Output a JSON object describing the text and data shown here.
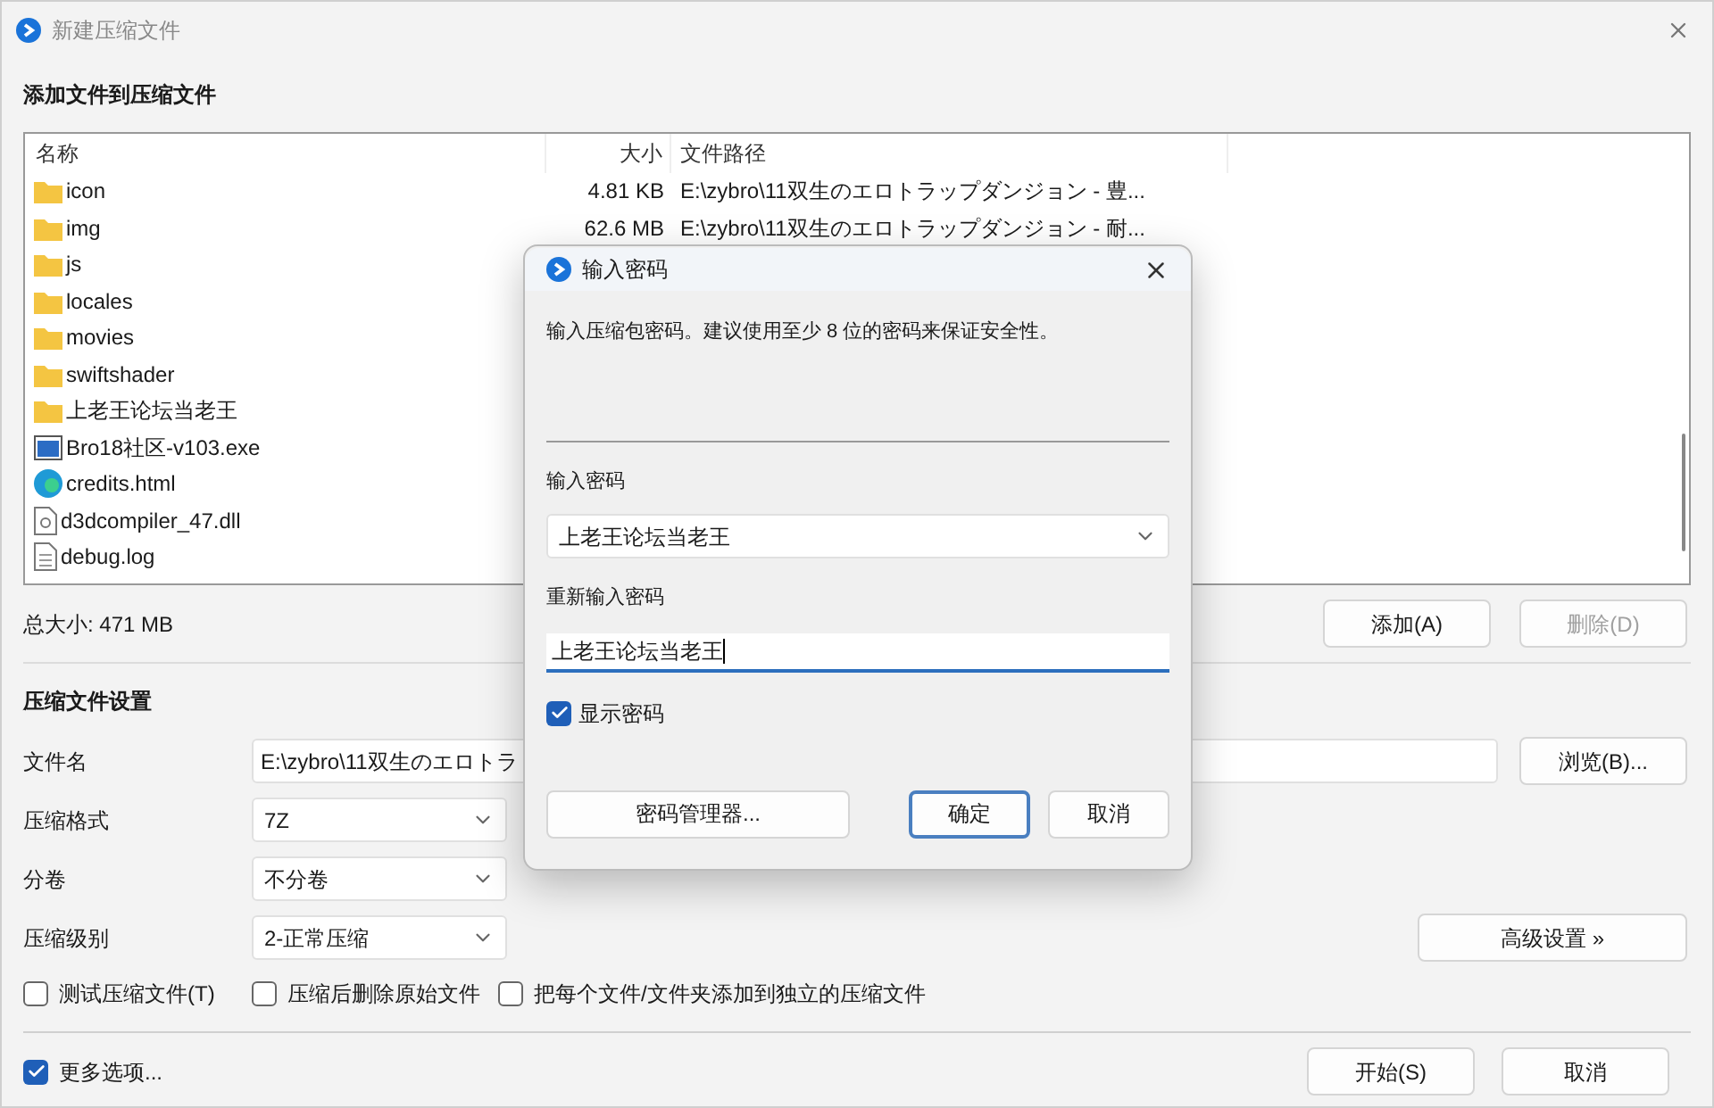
{
  "window": {
    "title": "新建压缩文件"
  },
  "files_section": {
    "heading": "添加文件到压缩文件",
    "columns": [
      "名称",
      "大小",
      "文件路径"
    ],
    "rows": [
      {
        "kind": "folder",
        "name": "icon",
        "size": "4.81 KB",
        "path": "E:\\zybro\\11双生のエロトラップダンジョン - 豊..."
      },
      {
        "kind": "folder",
        "name": "img",
        "size": "62.6 MB",
        "path": "E:\\zybro\\11双生のエロトラップダンジョン - 耐..."
      },
      {
        "kind": "folder",
        "name": "js"
      },
      {
        "kind": "folder",
        "name": "locales"
      },
      {
        "kind": "folder",
        "name": "movies"
      },
      {
        "kind": "folder",
        "name": "swiftshader"
      },
      {
        "kind": "folder",
        "name": "上老王论坛当老王"
      },
      {
        "kind": "exe",
        "name": "Bro18社区-v103.exe"
      },
      {
        "kind": "html",
        "name": "credits.html"
      },
      {
        "kind": "dll",
        "name": "d3dcompiler_47.dll"
      },
      {
        "kind": "log",
        "name": "debug.log"
      }
    ],
    "total": "总大小: 471 MB",
    "buttons": [
      {
        "label": "添加(A)",
        "disabled": false
      },
      {
        "label": "删除(D)",
        "disabled": true
      }
    ]
  },
  "settings": {
    "heading": "压缩文件设置",
    "file_name": {
      "label": "文件名",
      "value": "E:\\zybro\\11双生のエロトラ",
      "button": "浏览(B)..."
    },
    "format": {
      "label": "压缩格式",
      "value": "7Z"
    },
    "split": {
      "label": "分卷",
      "value": "不分卷"
    },
    "level": {
      "label": "压缩级别",
      "value": "2-正常压缩",
      "button": "高级设置 »"
    },
    "options": [
      {
        "label": "测试压缩文件(T)",
        "checked": false
      },
      {
        "label": "压缩后删除原始文件",
        "checked": false
      },
      {
        "label": "把每个文件/文件夹添加到独立的压缩文件",
        "checked": false
      }
    ]
  },
  "footer": {
    "more_options": {
      "label": "更多选项...",
      "checked": true
    },
    "buttons": [
      "开始(S)",
      "取消"
    ]
  },
  "password_dialog": {
    "title": "输入密码",
    "message": "输入压缩包密码。建议使用至少 8 位的密码来保证安全性。",
    "password_label": "输入密码",
    "password_value": "上老王论坛当老王",
    "confirm_label": "重新输入密码",
    "confirm_value": "上老王论坛当老王",
    "show_password": {
      "label": "显示密码",
      "checked": true
    },
    "buttons": [
      {
        "label": "密码管理器...",
        "default": false
      },
      {
        "label": "确定",
        "default": true
      },
      {
        "label": "取消",
        "default": false
      }
    ]
  }
}
